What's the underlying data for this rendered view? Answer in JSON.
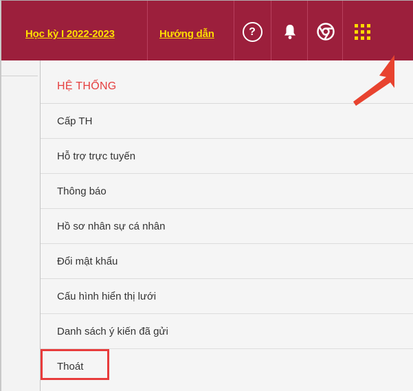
{
  "topbar": {
    "term_link": "Học kỳ I 2022-2023",
    "guide_link": "Hướng dẫn",
    "help_glyph": "?",
    "icons": [
      "help-icon",
      "bell-icon",
      "chrome-icon",
      "apps-grid-icon"
    ],
    "background_color": "#9c1f3c",
    "link_color": "#ffde00"
  },
  "menu": {
    "header": "HỆ THỐNG",
    "header_color": "#e53e3e",
    "items": [
      {
        "label": "Cấp TH"
      },
      {
        "label": "Hỗ trợ trực tuyến"
      },
      {
        "label": "Thông báo"
      },
      {
        "label": "Hồ sơ nhân sự cá nhân"
      },
      {
        "label": "Đổi mật khẩu"
      },
      {
        "label": "Cấu hình hiển thị lưới"
      },
      {
        "label": "Danh sách ý kiến đã gửi"
      },
      {
        "label": "Thoát"
      }
    ],
    "highlighted_item": "Thoát",
    "annotation_color": "#e83b3b"
  }
}
